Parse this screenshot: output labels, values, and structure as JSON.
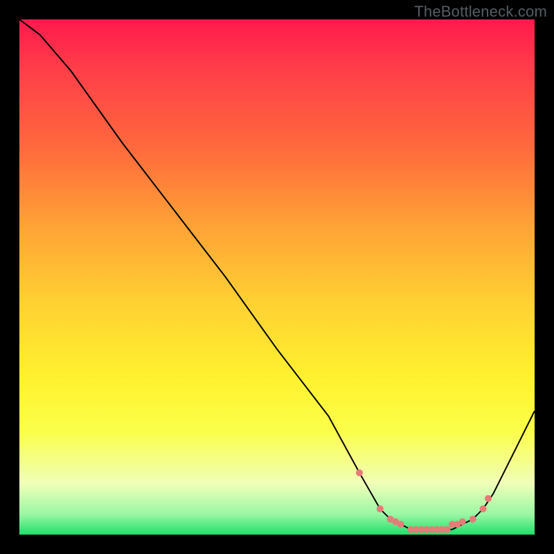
{
  "watermark": "TheBottleneck.com",
  "colors": {
    "frame": "#000000",
    "gradient_top": "#ff1a4d",
    "gradient_bottom": "#1fe06a",
    "curve": "#000000",
    "markers": "#e77b77"
  },
  "chart_data": {
    "type": "line",
    "title": "",
    "xlabel": "",
    "ylabel": "",
    "xlim": [
      0,
      100
    ],
    "ylim": [
      0,
      100
    ],
    "series": [
      {
        "name": "bottleneck-curve",
        "x": [
          0,
          4,
          10,
          20,
          30,
          40,
          50,
          60,
          66,
          70,
          72,
          74,
          76,
          78,
          80,
          82,
          84,
          86,
          88,
          90,
          92,
          94,
          100
        ],
        "y": [
          100,
          97,
          90,
          76,
          63,
          50,
          36,
          23,
          12,
          5,
          3,
          2,
          1,
          1,
          1,
          1,
          1,
          2,
          3,
          5,
          8,
          12,
          24
        ]
      }
    ],
    "markers": {
      "name": "highlight-points",
      "x": [
        66,
        70,
        72,
        73,
        74,
        76,
        77,
        78,
        79,
        80,
        81,
        82,
        83,
        84,
        85,
        86,
        88,
        90,
        91
      ],
      "y": [
        12,
        5,
        3,
        2.5,
        2,
        1,
        1,
        1,
        1,
        1,
        1,
        1,
        1,
        2,
        2,
        2.5,
        3,
        5,
        7
      ]
    }
  }
}
